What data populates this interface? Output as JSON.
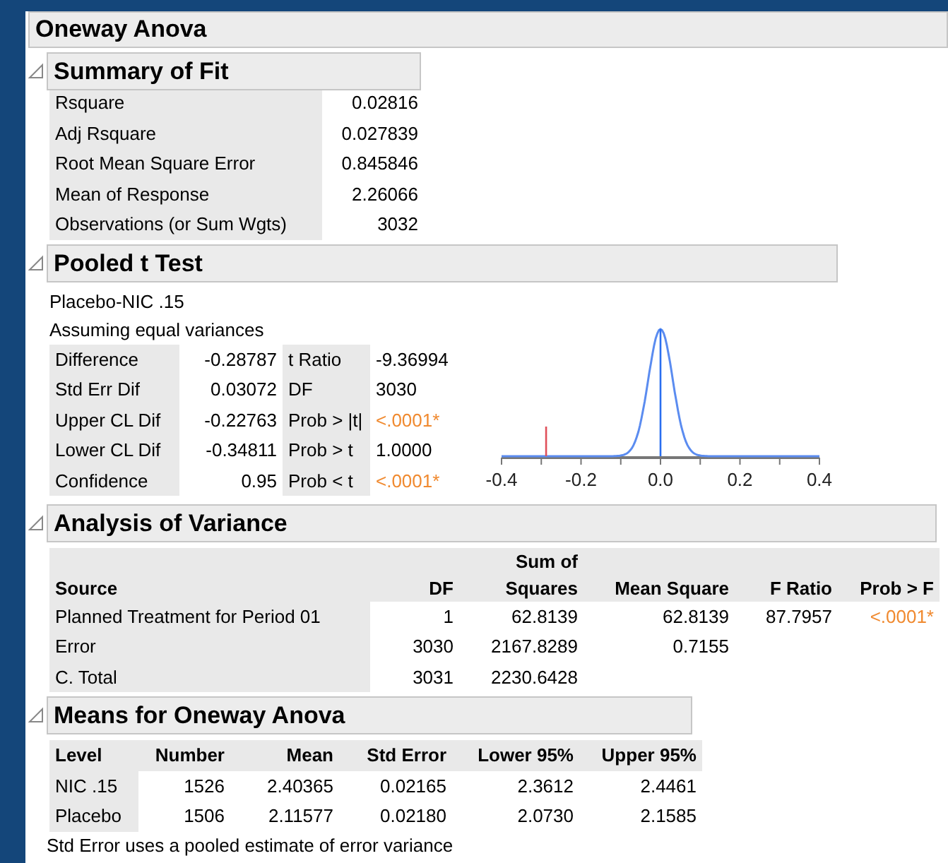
{
  "title": "Oneway Anova",
  "summary_of_fit": {
    "title": "Summary of Fit",
    "expanded": true,
    "rows": [
      {
        "label": "Rsquare",
        "value": "0.02816"
      },
      {
        "label": "Adj Rsquare",
        "value": "0.027839"
      },
      {
        "label": "Root Mean Square Error",
        "value": "0.845846"
      },
      {
        "label": "Mean of Response",
        "value": "2.26066"
      },
      {
        "label": "Observations (or Sum Wgts)",
        "value": "3032"
      }
    ]
  },
  "pooled_t_test": {
    "title": "Pooled t Test",
    "expanded": true,
    "comparison": "Placebo-NIC .15",
    "assumption": "Assuming equal variances",
    "rows": [
      {
        "label": "Difference",
        "value": "-0.28787",
        "stat": "t Ratio",
        "stat_value": "-9.36994",
        "significant": false
      },
      {
        "label": "Std Err Dif",
        "value": "0.03072",
        "stat": "DF",
        "stat_value": "3030",
        "significant": false
      },
      {
        "label": "Upper CL Dif",
        "value": "-0.22763",
        "stat": "Prob > |t|",
        "stat_value": "<.0001*",
        "significant": true
      },
      {
        "label": "Lower CL Dif",
        "value": "-0.34811",
        "stat": "Prob > t",
        "stat_value": "1.0000",
        "significant": false
      },
      {
        "label": "Confidence",
        "value": "0.95",
        "stat": "Prob < t",
        "stat_value": "<.0001*",
        "significant": true
      }
    ],
    "plot": {
      "x_tick_labels": [
        "-0.4",
        "-0.2",
        "0.0",
        "0.2",
        "0.4"
      ]
    }
  },
  "analysis_of_variance": {
    "title": "Analysis of Variance",
    "expanded": true,
    "columns": [
      "Source",
      "DF",
      "Sum of Squares",
      "Mean Square",
      "F Ratio",
      "Prob > F"
    ],
    "rows": [
      {
        "cells": [
          "Planned Treatment for Period 01",
          "1",
          "62.8139",
          "62.8139",
          "87.7957"
        ],
        "prob_f": {
          "value": "<.0001*",
          "significant": true
        }
      },
      {
        "cells": [
          "Error",
          "3030",
          "2167.8289",
          "0.7155"
        ]
      },
      {
        "cells": [
          "C. Total",
          "3031",
          "2230.6428"
        ]
      }
    ]
  },
  "means": {
    "title": "Means for Oneway Anova",
    "expanded": true,
    "columns": [
      "Level",
      "Number",
      "Mean",
      "Std Error",
      "Lower 95%",
      "Upper 95%"
    ],
    "rows": [
      {
        "cells": [
          "NIC .15",
          "1526",
          "2.40365",
          "0.02165",
          "2.3612",
          "2.4461"
        ]
      },
      {
        "cells": [
          "Placebo",
          "1506",
          "2.11577",
          "0.02180",
          "2.0730",
          "2.1585"
        ]
      }
    ],
    "note": "Std Error uses a pooled estimate of error variance"
  }
}
